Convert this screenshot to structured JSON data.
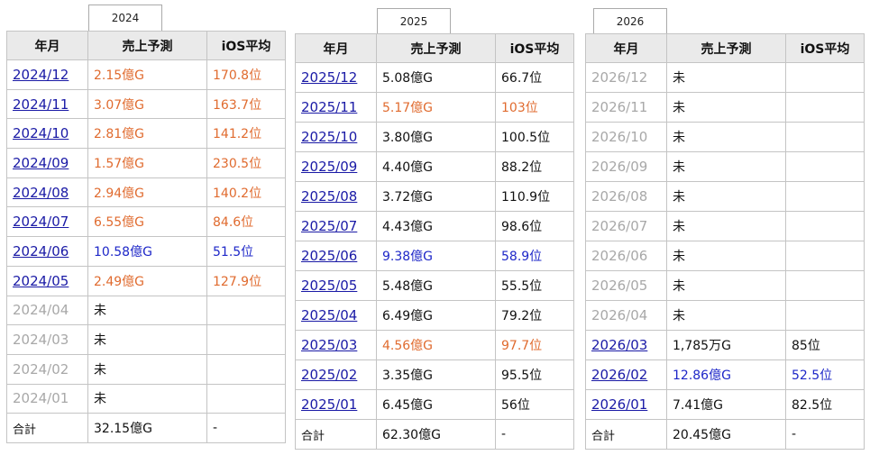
{
  "headers": {
    "month": "年月",
    "sales": "売上予測",
    "ios": "iOS平均"
  },
  "colors": {
    "link": "#1a1aa6",
    "gray": "#a8a8a8",
    "orange": "#e06b2f",
    "blue": "#1e27c8",
    "header_bg": "#eaeaea"
  },
  "years": [
    {
      "label": "2024",
      "rows": [
        {
          "month": "2024/12",
          "sales": "2.15億G",
          "ios": "170.8位",
          "state": "link",
          "color": "orange"
        },
        {
          "month": "2024/11",
          "sales": "3.07億G",
          "ios": "163.7位",
          "state": "link",
          "color": "orange"
        },
        {
          "month": "2024/10",
          "sales": "2.81億G",
          "ios": "141.2位",
          "state": "link",
          "color": "orange"
        },
        {
          "month": "2024/09",
          "sales": "1.57億G",
          "ios": "230.5位",
          "state": "link",
          "color": "orange"
        },
        {
          "month": "2024/08",
          "sales": "2.94億G",
          "ios": "140.2位",
          "state": "link",
          "color": "orange"
        },
        {
          "month": "2024/07",
          "sales": "6.55億G",
          "ios": "84.6位",
          "state": "link",
          "color": "orange"
        },
        {
          "month": "2024/06",
          "sales": "10.58億G",
          "ios": "51.5位",
          "state": "link",
          "color": "blue"
        },
        {
          "month": "2024/05",
          "sales": "2.49億G",
          "ios": "127.9位",
          "state": "link",
          "color": "orange"
        },
        {
          "month": "2024/04",
          "sales": "未",
          "ios": "",
          "state": "gray",
          "color": "black"
        },
        {
          "month": "2024/03",
          "sales": "未",
          "ios": "",
          "state": "gray",
          "color": "black"
        },
        {
          "month": "2024/02",
          "sales": "未",
          "ios": "",
          "state": "gray",
          "color": "black"
        },
        {
          "month": "2024/01",
          "sales": "未",
          "ios": "",
          "state": "gray",
          "color": "black"
        }
      ],
      "total": {
        "label": "合計",
        "sales": "32.15億G",
        "ios": "-"
      }
    },
    {
      "label": "2025",
      "rows": [
        {
          "month": "2025/12",
          "sales": "5.08億G",
          "ios": "66.7位",
          "state": "link",
          "color": "black"
        },
        {
          "month": "2025/11",
          "sales": "5.17億G",
          "ios": "103位",
          "state": "link",
          "color": "orange"
        },
        {
          "month": "2025/10",
          "sales": "3.80億G",
          "ios": "100.5位",
          "state": "link",
          "color": "black"
        },
        {
          "month": "2025/09",
          "sales": "4.40億G",
          "ios": "88.2位",
          "state": "link",
          "color": "black"
        },
        {
          "month": "2025/08",
          "sales": "3.72億G",
          "ios": "110.9位",
          "state": "link",
          "color": "black"
        },
        {
          "month": "2025/07",
          "sales": "4.43億G",
          "ios": "98.6位",
          "state": "link",
          "color": "black"
        },
        {
          "month": "2025/06",
          "sales": "9.38億G",
          "ios": "58.9位",
          "state": "link",
          "color": "blue"
        },
        {
          "month": "2025/05",
          "sales": "5.48億G",
          "ios": "55.5位",
          "state": "link",
          "color": "black"
        },
        {
          "month": "2025/04",
          "sales": "6.49億G",
          "ios": "79.2位",
          "state": "link",
          "color": "black"
        },
        {
          "month": "2025/03",
          "sales": "4.56億G",
          "ios": "97.7位",
          "state": "link",
          "color": "orange"
        },
        {
          "month": "2025/02",
          "sales": "3.35億G",
          "ios": "95.5位",
          "state": "link",
          "color": "black"
        },
        {
          "month": "2025/01",
          "sales": "6.45億G",
          "ios": "56位",
          "state": "link",
          "color": "black"
        }
      ],
      "total": {
        "label": "合計",
        "sales": "62.30億G",
        "ios": "-"
      }
    },
    {
      "label": "2026",
      "rows": [
        {
          "month": "2026/12",
          "sales": "未",
          "ios": "",
          "state": "gray",
          "color": "black"
        },
        {
          "month": "2026/11",
          "sales": "未",
          "ios": "",
          "state": "gray",
          "color": "black"
        },
        {
          "month": "2026/10",
          "sales": "未",
          "ios": "",
          "state": "gray",
          "color": "black"
        },
        {
          "month": "2026/09",
          "sales": "未",
          "ios": "",
          "state": "gray",
          "color": "black"
        },
        {
          "month": "2026/08",
          "sales": "未",
          "ios": "",
          "state": "gray",
          "color": "black"
        },
        {
          "month": "2026/07",
          "sales": "未",
          "ios": "",
          "state": "gray",
          "color": "black"
        },
        {
          "month": "2026/06",
          "sales": "未",
          "ios": "",
          "state": "gray",
          "color": "black"
        },
        {
          "month": "2026/05",
          "sales": "未",
          "ios": "",
          "state": "gray",
          "color": "black"
        },
        {
          "month": "2026/04",
          "sales": "未",
          "ios": "",
          "state": "gray",
          "color": "black"
        },
        {
          "month": "2026/03",
          "sales": "1,785万G",
          "ios": "85位",
          "state": "link",
          "color": "black"
        },
        {
          "month": "2026/02",
          "sales": "12.86億G",
          "ios": "52.5位",
          "state": "link",
          "color": "blue"
        },
        {
          "month": "2026/01",
          "sales": "7.41億G",
          "ios": "82.5位",
          "state": "link",
          "color": "black"
        }
      ],
      "total": {
        "label": "合計",
        "sales": "20.45億G",
        "ios": "-"
      }
    }
  ]
}
